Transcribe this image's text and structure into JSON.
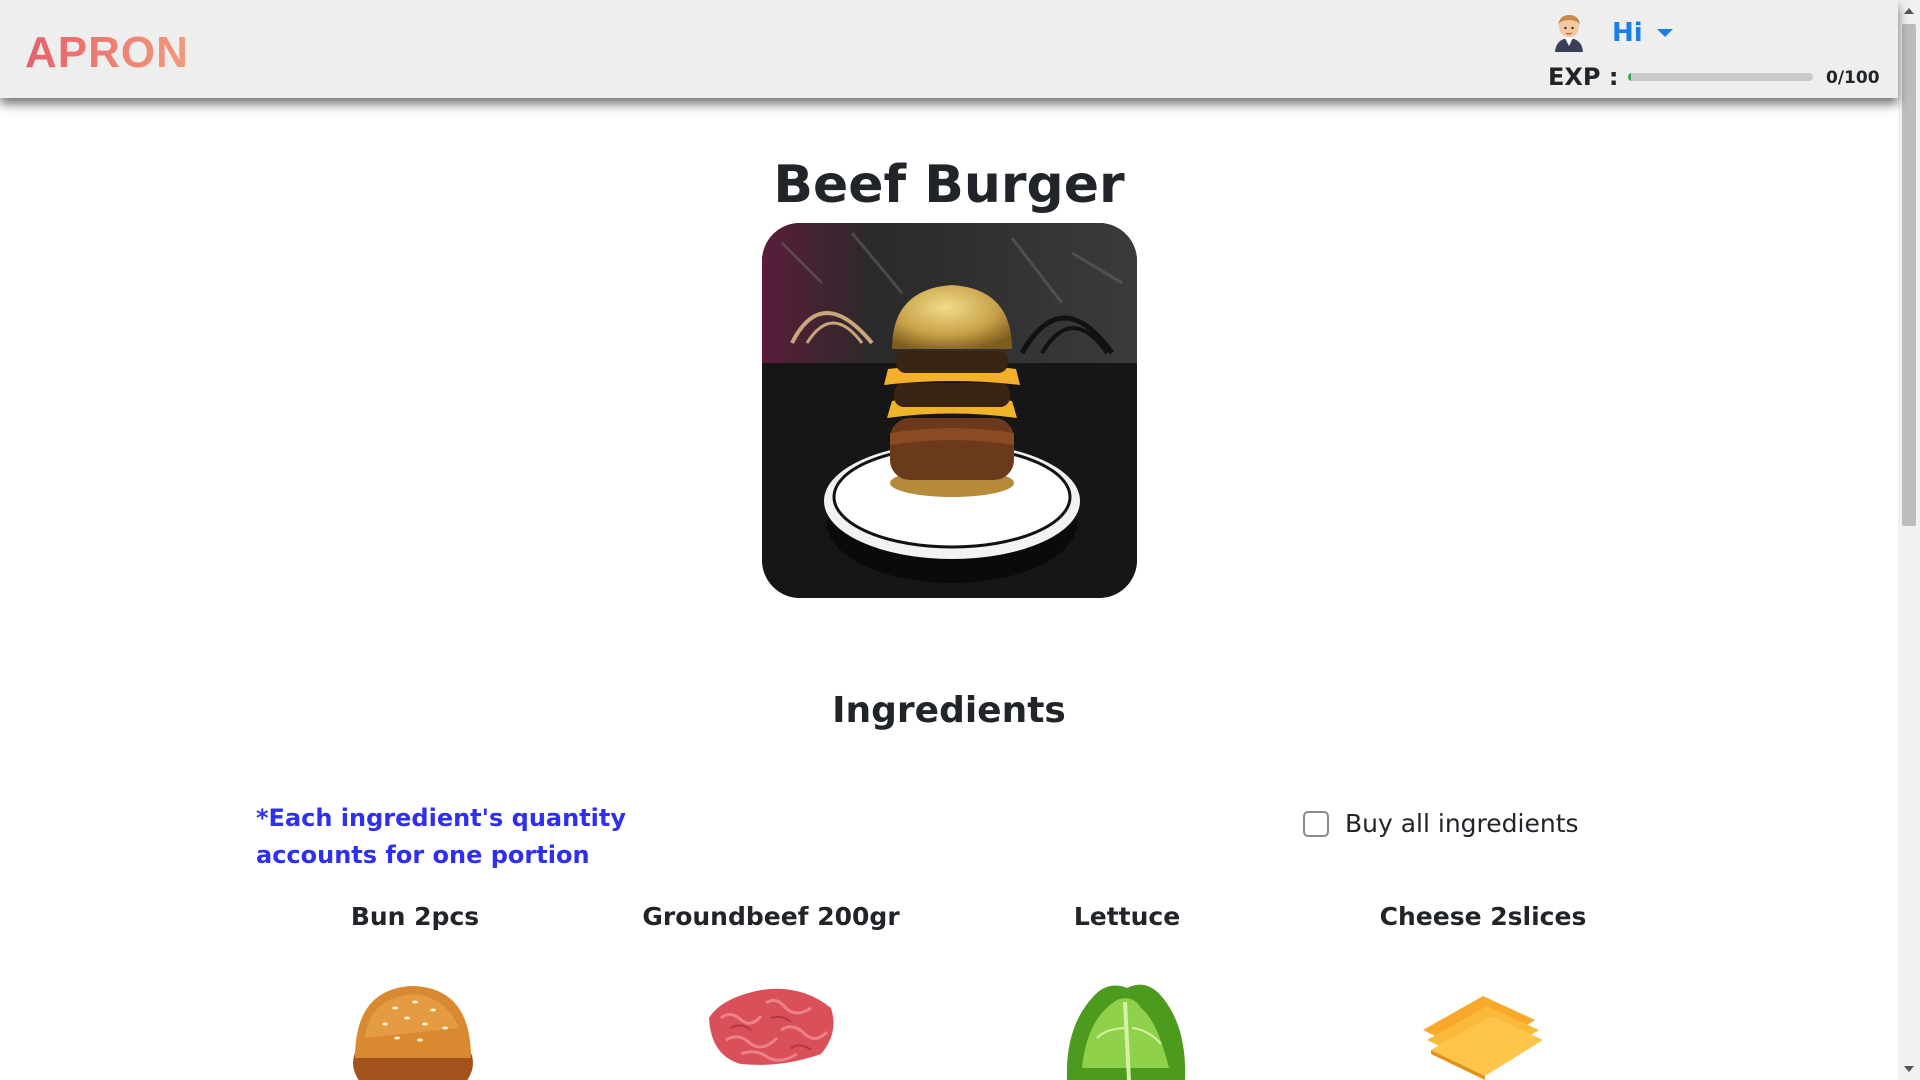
{
  "header": {
    "logo": "APRON",
    "greeting": "Hi",
    "exp_label": "EXP :",
    "exp_count": "0/100",
    "exp_progress_percent": 0
  },
  "recipe": {
    "title": "Beef Burger"
  },
  "ingredients_section": {
    "title": "Ingredients",
    "note": "*Each ingredient's quantity accounts for one portion",
    "buy_all_label": "Buy all ingredients",
    "buy_all_checked": false,
    "items": [
      {
        "label": "Bun 2pcs",
        "icon": "bun-image"
      },
      {
        "label": "Groundbeef 200gr",
        "icon": "ground-beef-image"
      },
      {
        "label": "Lettuce",
        "icon": "lettuce-image"
      },
      {
        "label": "Cheese 2slices",
        "icon": "cheese-image"
      }
    ]
  },
  "colors": {
    "accent": "#1a7ee6",
    "note": "#2f2ff0",
    "logo_start": "#e8606a",
    "logo_end": "#f29a7c",
    "progress": "#2faa46"
  }
}
